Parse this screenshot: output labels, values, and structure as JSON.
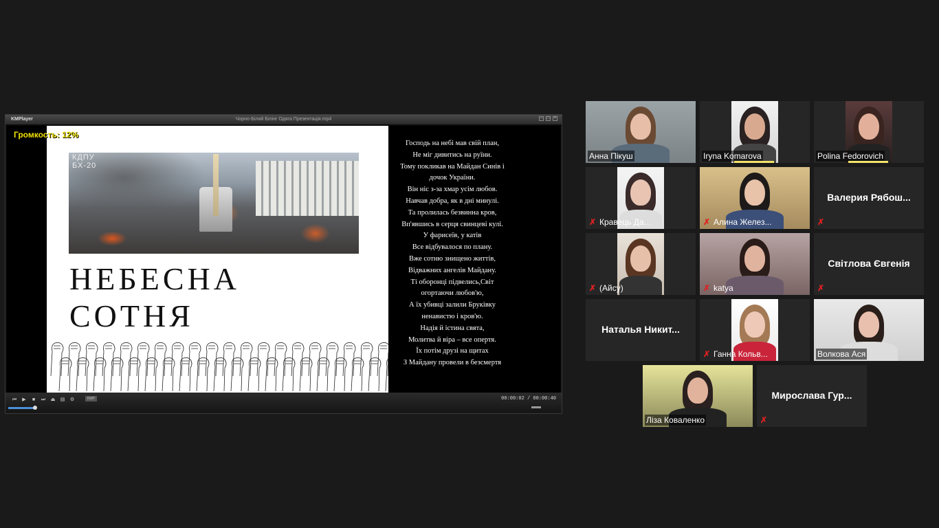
{
  "player": {
    "app_name": "KMPlayer",
    "file_name": "Чорно-Білий Білінг Одяга Презентація.mp4",
    "volume_osd": "Громкость: 12%",
    "slide": {
      "school": "КДПУ\nБХ-20",
      "title_line1": "НЕБЕСНА",
      "title_line2": "СОТНЯ"
    },
    "poem": [
      "Господь на небі мав свій план,",
      "Не міг дивитись на руїни.",
      "Тому покликав на Майдан Синів і",
      "дочок України.",
      "Він ніс з-за хмар усім любов.",
      "Навчав добра, як в дні минулі.",
      "Та пролилась безвинна кров,",
      "Вп'явшись в серця свинцеві кулі.",
      "У фарисеїв, у катів",
      "Все відбувалося по плану.",
      "Вже сотню знищено життів,",
      "Відважних ангелів Майдану.",
      "Ті оборонці підвелись,Світ",
      "огортаючи любов'ю,",
      "А їх убивці залили Бруківку",
      "ненавистю і кров'ю.",
      "Надія й істина свята,",
      "Молитва й віра – все опертя.",
      "Їх потім друзі на щитах",
      "З Майдану провели в безсмертя"
    ],
    "time": "00:00:02 / 00:00:40",
    "progress": 0.05
  },
  "participants": [
    {
      "name": "Анна Пікуш",
      "muted": false,
      "video": true
    },
    {
      "name": "Iryna Komarova",
      "muted": false,
      "video": true
    },
    {
      "name": "Polina Fedorovich",
      "muted": false,
      "video": true
    },
    {
      "name": "Кравець Да...",
      "muted": true,
      "video": true
    },
    {
      "name": "Алина Желез...",
      "muted": true,
      "video": true
    },
    {
      "name": "Валерия  Рябош...",
      "muted": true,
      "video": false
    },
    {
      "name": "(Айсу)",
      "muted": true,
      "video": true
    },
    {
      "name": "katya",
      "muted": true,
      "video": true
    },
    {
      "name": "Світлова Євгенія",
      "muted": true,
      "video": false
    },
    {
      "name": "Наталья  Никит...",
      "muted": false,
      "video": false
    },
    {
      "name": "Ганна Кольв...",
      "muted": true,
      "video": true
    },
    {
      "name": "Волкова Ася",
      "muted": false,
      "video": true
    },
    {
      "name": "Ліза Коваленко",
      "muted": false,
      "video": true,
      "active_speaker": true
    },
    {
      "name": "Мирослава  Гур...",
      "muted": true,
      "video": false
    }
  ],
  "icons": {
    "muted": "mic-muted-icon"
  },
  "colors": {
    "active_speaker": "#f3f07d",
    "muted_icon": "#e02020",
    "volume_osd": "#f0e000"
  }
}
